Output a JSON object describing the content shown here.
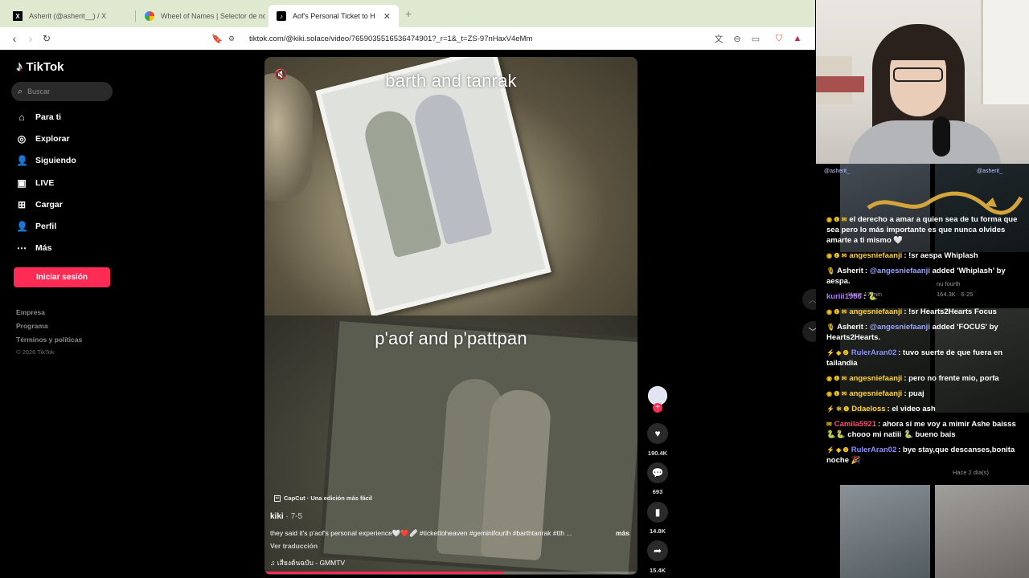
{
  "browser": {
    "tabs": [
      {
        "title": "Asherit (@asherit__) / X",
        "favicon": "X"
      },
      {
        "title": "Wheel of Names | Selector de nomb",
        "favicon": "G"
      },
      {
        "title": "Aof's Personal Ticket to Heaven",
        "favicon": "♪"
      }
    ],
    "url": "tiktok.com/@kiki.solace/video/7659035516536474901?_r=1&_t=ZS-97nHaxV4eMm"
  },
  "sidebar": {
    "logo": "TikTok",
    "search_placeholder": "Buscar",
    "menu": [
      {
        "label": "Para ti",
        "icon": "home-icon"
      },
      {
        "label": "Explorar",
        "icon": "compass-icon"
      },
      {
        "label": "Siguiendo",
        "icon": "people-icon"
      },
      {
        "label": "LIVE",
        "icon": "live-icon"
      },
      {
        "label": "Cargar",
        "icon": "upload-icon"
      },
      {
        "label": "Perfil",
        "icon": "profile-icon"
      },
      {
        "label": "Más",
        "icon": "more-icon"
      }
    ],
    "login_label": "Iniciar sesión",
    "footer_links": [
      "Empresa",
      "Programa",
      "Términos y políticas"
    ],
    "copyright": "© 2026 TikTok"
  },
  "video": {
    "caption_top": "barth and tanrak",
    "caption_bottom": "p'aof and p'pattpan",
    "watermark": "CapCut · Una edición más fácil",
    "author": "kiki",
    "date": " · 7-5",
    "description": "they said it's p'aof's personal experience🤍❤️🩹 #tickettoheaven #geminifourth #barthtanrak #tth ...",
    "more_label": "más",
    "translate_label": "Ver traducción",
    "music": "เสียงต้นฉบับ - GMMTV",
    "progress": 0.64
  },
  "actions": {
    "likes": "190.4K",
    "comments": "693",
    "saves": "14.8K",
    "shares": "15.4K"
  },
  "overlay": {
    "handle_left": "@asherit_",
    "handle_right": "@asherit_",
    "chat": [
      {
        "badges": "◉ ❶ ✉",
        "user": "",
        "text": "el derecho a amar a quien sea de tu forma que sea pero lo más importante es que nunca olvides amarte a ti mismo 🤍",
        "user_color": "#ffffff"
      },
      {
        "badges": "◉ ❶ ✉",
        "user": "angesniefaanji",
        "text": ": !sr aespa Whiplash",
        "user_color": "#ffd23a"
      },
      {
        "badges": "🎙",
        "user": "Asherit",
        "text": ": ",
        "mention": "@angesniefaanji",
        "after": " added 'Whiplash' by aespa.",
        "user_color": "#ffffff"
      },
      {
        "badges": "",
        "user": "kuriii1986",
        "text": ": 🐍",
        "user_color": "#b37bff"
      },
      {
        "badges": "◉ ❶ ✉",
        "user": "angesniefaanji",
        "text": ": !sr Hearts2Hearts Focus",
        "user_color": "#ffd23a"
      },
      {
        "badges": "🎙",
        "user": "Asherit",
        "text": ": ",
        "mention": "@angesniefaanji",
        "after": " added 'FOCUS' by Hearts2Hearts.",
        "user_color": "#ffffff"
      },
      {
        "badges": "⚡ ◆ ❶",
        "user": "RulerAran02",
        "text": ": tuvo suerte de que fuera en tailandia",
        "user_color": "#8a8fff"
      },
      {
        "badges": "◉ ❶ ✉",
        "user": "angesniefaanji",
        "text": ": pero no frente mio, porfa",
        "user_color": "#ffd23a"
      },
      {
        "badges": "◉ ❶ ✉",
        "user": "angesniefaanji",
        "text": ": puaj",
        "user_color": "#ffd23a"
      },
      {
        "badges": "⚡ ✻ ❶",
        "user": "Ddaeloss",
        "text": ": el video ash",
        "user_color": "#ffd23a"
      },
      {
        "badges": "✉",
        "user": "Camila5921",
        "text": ": ahora sí me voy a mimir Ashe baisss 🐍🐍 chooo mi natiii 🐍 bueno bais",
        "user_color": "#ff4d6d"
      },
      {
        "badges": "⚡ ◆ ❶",
        "user": "RulerAran02",
        "text": ": bye stay,que descanses,bonita noche 🎉",
        "user_color": "#8a8fff"
      }
    ],
    "ghost_texts": [
      "Hace 17 min",
      "164.3K · 6-25",
      "Hace 2 día(s)",
      "nu fourth"
    ]
  },
  "colors": {
    "accent": "#fe2c55",
    "tabbar": "#dfe9cf"
  }
}
